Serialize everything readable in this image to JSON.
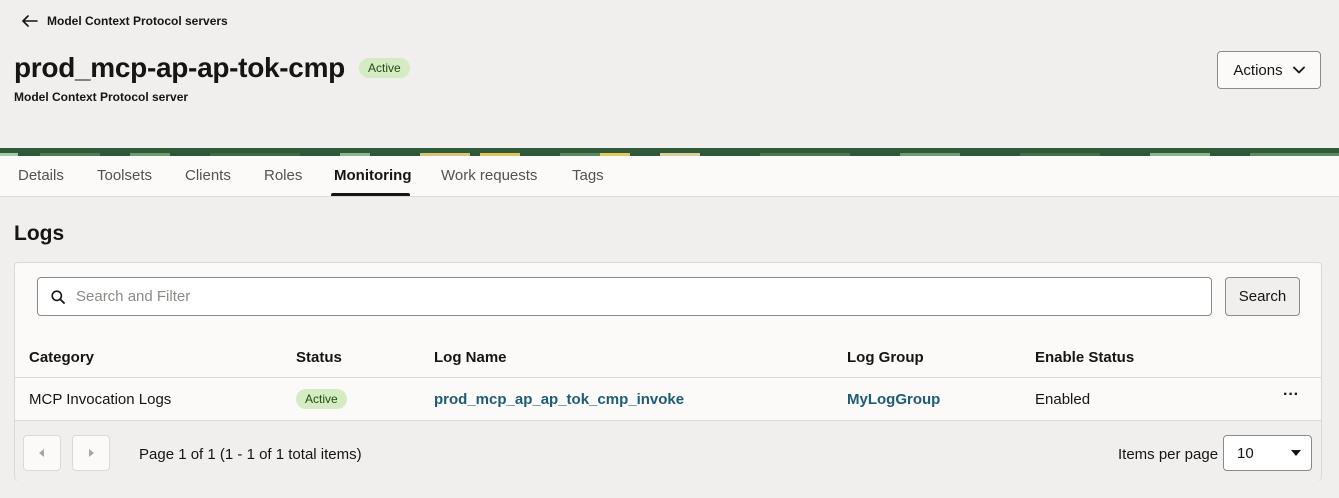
{
  "header": {
    "back_label": "Model Context Protocol servers",
    "title": "prod_mcp-ap-ap-tok-cmp",
    "status_badge": "Active",
    "subtitle": "Model Context Protocol server",
    "actions_label": "Actions"
  },
  "tabs": [
    {
      "label": "Details"
    },
    {
      "label": "Toolsets"
    },
    {
      "label": "Clients"
    },
    {
      "label": "Roles"
    },
    {
      "label": "Monitoring",
      "active": true
    },
    {
      "label": "Work requests"
    },
    {
      "label": "Tags"
    }
  ],
  "logs": {
    "title": "Logs",
    "search": {
      "placeholder": "Search and Filter",
      "value": "",
      "button_label": "Search"
    },
    "columns": [
      "Category",
      "Status",
      "Log Name",
      "Log Group",
      "Enable Status"
    ],
    "rows": [
      {
        "category": "MCP Invocation Logs",
        "status": "Active",
        "log_name": "prod_mcp_ap_ap_tok_cmp_invoke",
        "log_group": "MyLogGroup",
        "enable_status": "Enabled",
        "menu": "···"
      }
    ],
    "pagination": {
      "summary": "Page 1 of 1 (1 - 1 of 1 total items)",
      "items_per_page_label": "Items per page",
      "items_per_page_value": "10"
    }
  },
  "colors": {
    "accent_link": "#1f5c7a",
    "badge_bg": "#d4ebc3",
    "badge_text": "#1f4d0e",
    "page_bg": "#f1efed"
  }
}
